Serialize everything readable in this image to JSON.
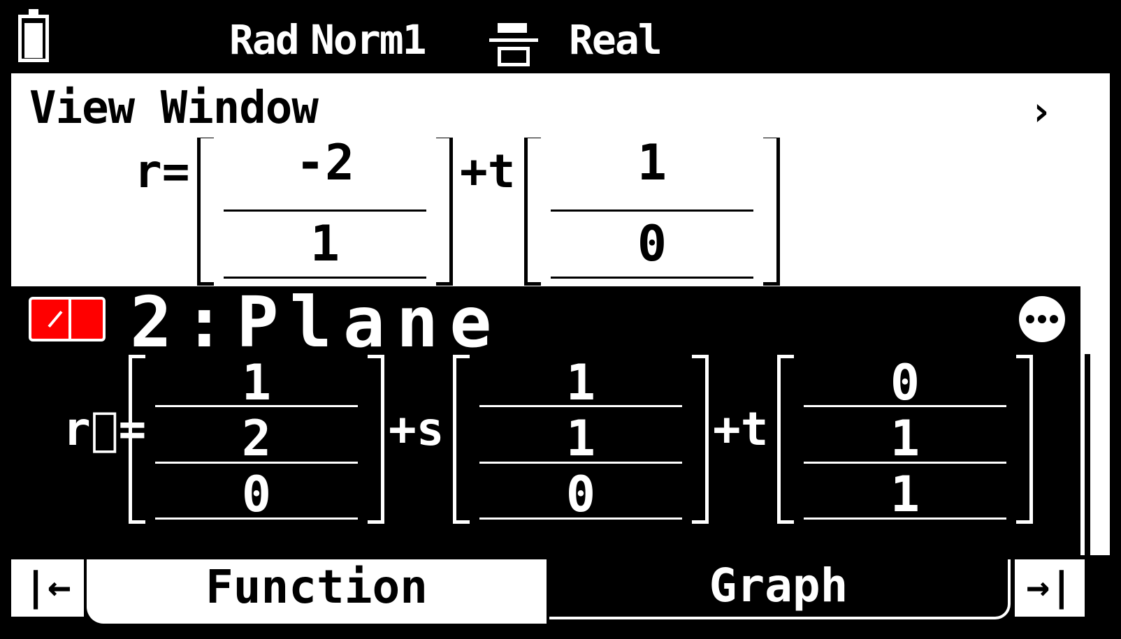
{
  "status_bar": {
    "angle_unit": "Rad",
    "display_format": "Norm1",
    "input_output_icon": "fraction-icon",
    "complex_mode": "Real",
    "battery_icon": "battery-icon"
  },
  "title_bar": {
    "title": "View Window",
    "next_icon": "›"
  },
  "entries": [
    {
      "label": "r=",
      "terms": [
        {
          "operator": "",
          "values": [
            "-2",
            "1"
          ]
        },
        {
          "operator": "+t",
          "values": [
            "1",
            "0"
          ]
        }
      ]
    },
    {
      "title": "2:Plane",
      "color": "#ff0000",
      "more_icon": "more-icon",
      "label": "r⃗=",
      "terms": [
        {
          "operator": "",
          "values": [
            "1",
            "2",
            "0"
          ]
        },
        {
          "operator": "+s",
          "values": [
            "1",
            "1",
            "0"
          ]
        },
        {
          "operator": "+t",
          "values": [
            "0",
            "1",
            "1"
          ]
        }
      ]
    }
  ],
  "tabs": {
    "first": "|←",
    "function": "Function",
    "graph": "Graph",
    "last": "→|"
  }
}
